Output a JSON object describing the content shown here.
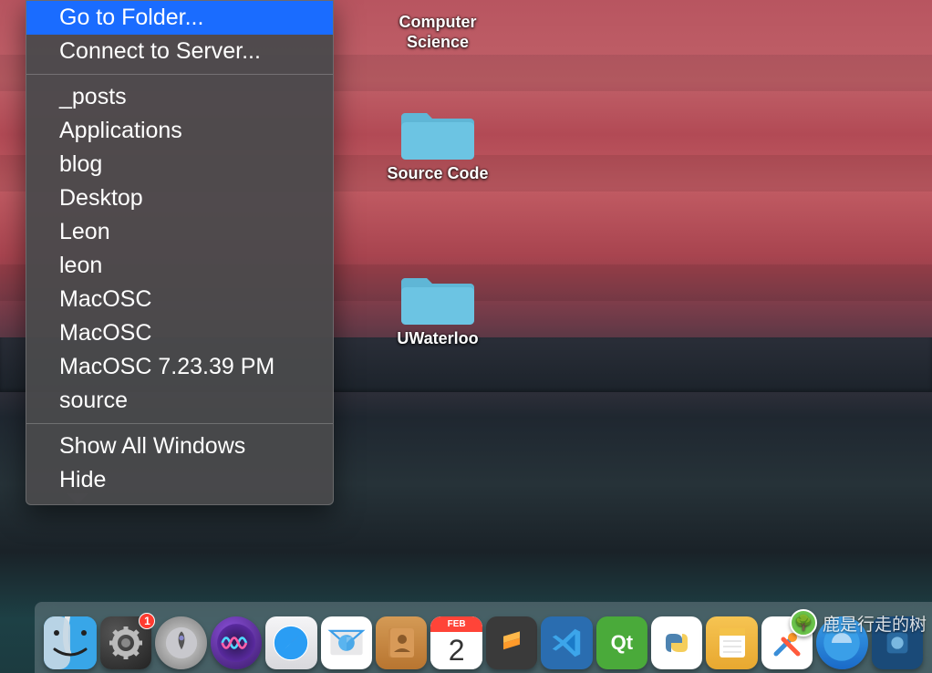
{
  "menu": {
    "go_to_folder": "Go to Folder...",
    "connect_to_server": "Connect to Server...",
    "recent": {
      "posts": "_posts",
      "applications": "Applications",
      "blog": "blog",
      "desktop": "Desktop",
      "leon_cap": "Leon",
      "leon_low": "leon",
      "macosc1": "MacOSC",
      "macosc2": "MacOSC",
      "macosc3": "MacOSC 7.23.39 PM",
      "source": "source"
    },
    "show_all_windows": "Show All Windows",
    "hide": "Hide"
  },
  "desktop_folders": {
    "computer_science": "Computer\nScience",
    "source_code": "Source Code",
    "uwaterloo": "UWaterloo"
  },
  "dock": {
    "calendar_month": "FEB",
    "calendar_day": "2",
    "settings_badge": "1"
  },
  "watermark": "鹿是行走的树"
}
